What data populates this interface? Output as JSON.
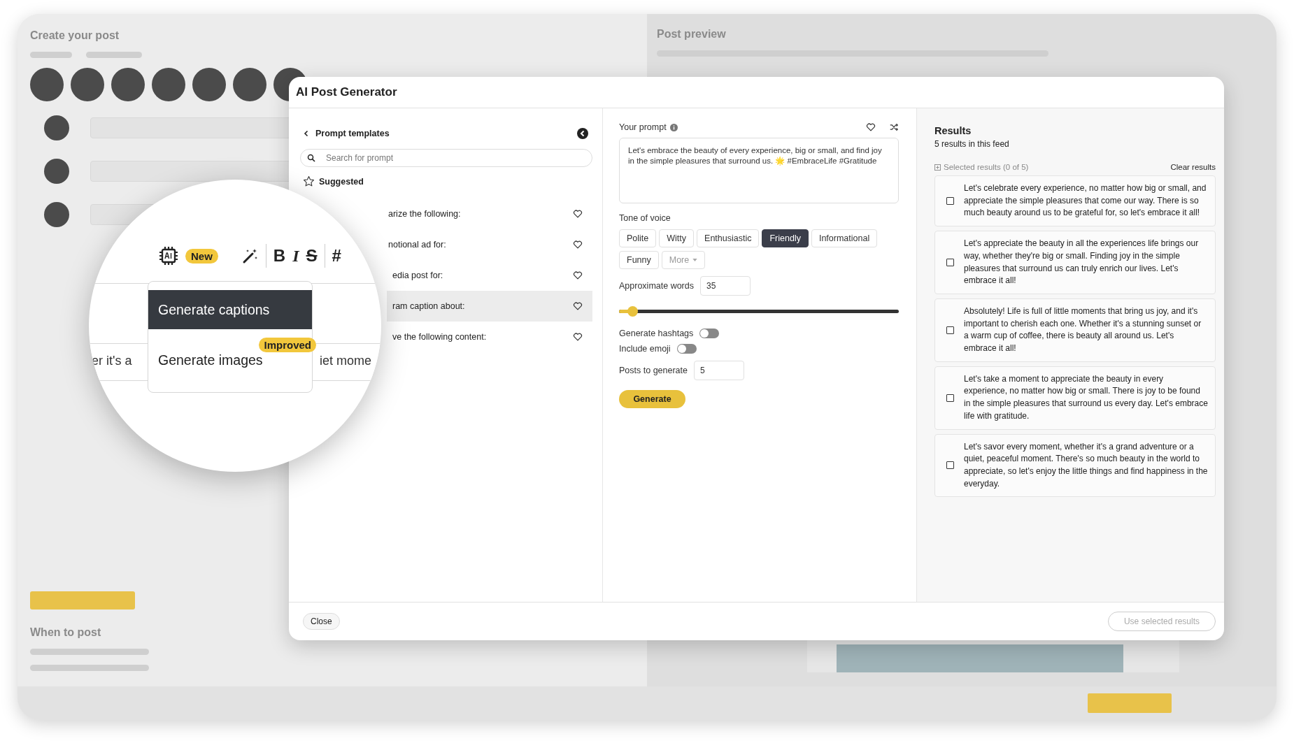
{
  "background": {
    "left_title": "Create your post",
    "right_title": "Post preview",
    "section_title": "When to post"
  },
  "modal": {
    "title": "AI Post Generator"
  },
  "templates": {
    "title": "Prompt templates",
    "search": {
      "placeholder": "Search for prompt"
    },
    "section": "Suggested",
    "items": [
      {
        "text": "arize the following:",
        "selected": false
      },
      {
        "text": "notional ad for:",
        "selected": false
      },
      {
        "text": "edia post for:",
        "selected": false
      },
      {
        "text": "ram caption about:",
        "selected": true
      },
      {
        "text": "ve the following content:",
        "selected": false
      }
    ]
  },
  "prompt": {
    "label": "Your prompt",
    "value": "Let's embrace the beauty of every experience, big or small, and find joy in the simple pleasures that surround us. 🌟 #EmbraceLife #Gratitude"
  },
  "tone": {
    "label": "Tone of voice",
    "options": [
      {
        "label": "Polite",
        "selected": false
      },
      {
        "label": "Witty",
        "selected": false
      },
      {
        "label": "Enthusiastic",
        "selected": false
      },
      {
        "label": "Friendly",
        "selected": true
      },
      {
        "label": "Informational",
        "selected": false
      },
      {
        "label": "Funny",
        "selected": false
      }
    ],
    "more": "More"
  },
  "words": {
    "label": "Approximate words",
    "value": "35",
    "level": 0.05
  },
  "toggles": [
    {
      "label": "Generate hashtags",
      "on": false
    },
    {
      "label": "Include emoji",
      "on": false
    }
  ],
  "posts": {
    "label": "Posts to generate",
    "value": "5"
  },
  "generate": "Generate",
  "results": {
    "title": "Results",
    "subtitle": "5 results in this feed",
    "selected_label": "Selected results (0 of 5)",
    "clear": "Clear results",
    "items": [
      {
        "text": "Let's celebrate every experience, no matter how big or small, and appreciate the simple pleasures that come our way. There is so much beauty around us to be grateful for, so let's embrace it all!",
        "checked": false
      },
      {
        "text": "Let's appreciate the beauty in all the experiences life brings our way, whether they're big or small. Finding joy in the simple pleasures that surround us can truly enrich our lives. Let's embrace it all!",
        "checked": false
      },
      {
        "text": "Absolutely! Life is full of little moments that bring us joy, and it's important to cherish each one. Whether it's a stunning sunset or a warm cup of coffee, there is beauty all around us. Let's embrace it all!",
        "checked": false
      },
      {
        "text": "Let's take a moment to appreciate the beauty in every experience, no matter how big or small. There is joy to be found in the simple pleasures that surround us every day. Let's embrace life with gratitude.",
        "checked": false
      },
      {
        "text": "Let's savor every moment, whether it's a grand adventure or a quiet, peaceful moment. There's so much beauty in the world to appreciate, so let's enjoy the little things and find happiness in the everyday.",
        "checked": false
      }
    ]
  },
  "footer": {
    "close": "Close",
    "use": "Use selected results",
    "use_disabled": true
  },
  "magnifier": {
    "badge": "New",
    "format_buttons": [
      {
        "label": "B",
        "kind": "bold"
      },
      {
        "label": "I",
        "kind": "italic"
      },
      {
        "label": "S",
        "kind": "strike"
      },
      {
        "label": "#",
        "kind": "plain"
      }
    ],
    "menu": [
      {
        "label": "Generate captions",
        "selected": true
      },
      {
        "label": "Generate images",
        "selected": false,
        "badge": "Improved"
      }
    ],
    "fragments": [
      "er it's a",
      "iet mome"
    ]
  }
}
